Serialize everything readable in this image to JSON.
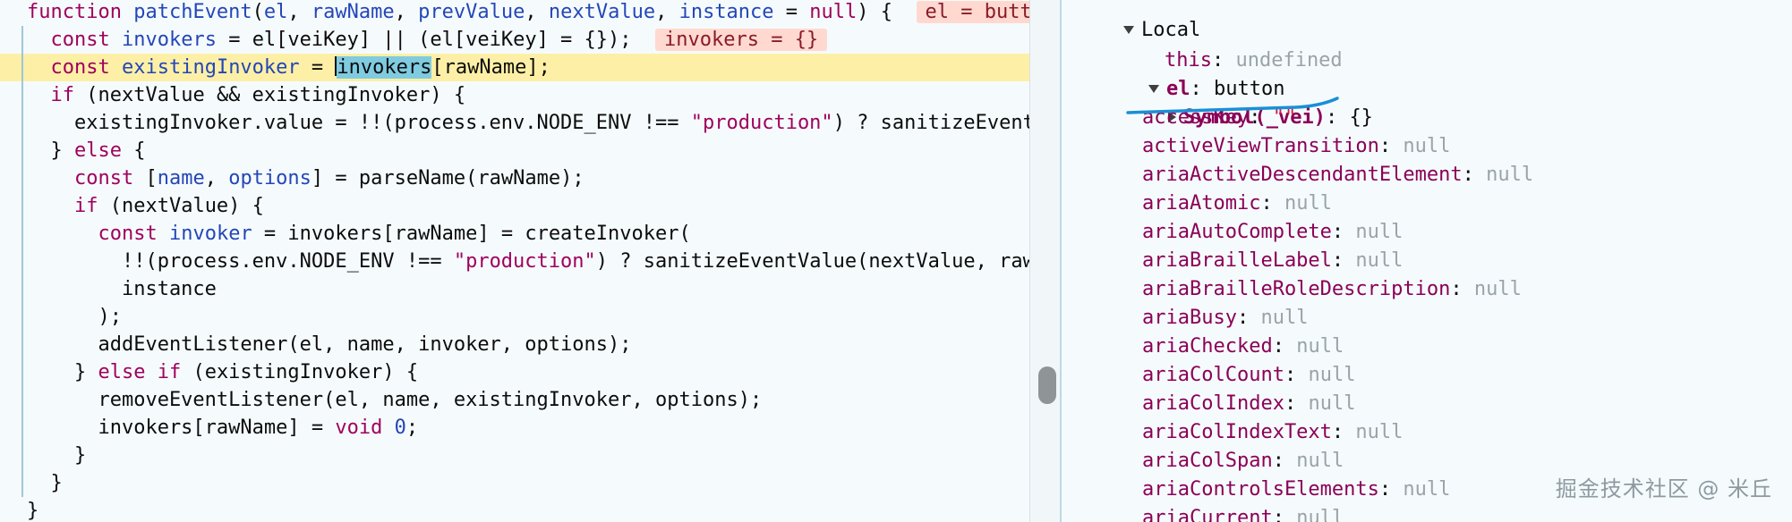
{
  "editor": {
    "lines": [
      {
        "parts": [
          [
            "kw",
            "function "
          ],
          [
            "fn",
            "patchEvent"
          ],
          [
            "",
            "("
          ],
          [
            "df",
            "el"
          ],
          [
            "",
            ", "
          ],
          [
            "df",
            "rawName"
          ],
          [
            "",
            ", "
          ],
          [
            "df",
            "prevValue"
          ],
          [
            "",
            ", "
          ],
          [
            "df",
            "nextValue"
          ],
          [
            "",
            ", "
          ],
          [
            "df",
            "instance"
          ],
          [
            "",
            " = "
          ],
          [
            "kw",
            "null"
          ],
          [
            "",
            ") {  "
          ]
        ],
        "preview": "el = button",
        "previewCut": true
      },
      {
        "parts": [
          [
            "",
            "  "
          ],
          [
            "kw",
            "const "
          ],
          [
            "df",
            "invokers"
          ],
          [
            "",
            " = el[veiKey] || (el[veiKey] = {});  "
          ]
        ],
        "preview": "invokers = {}"
      },
      {
        "parts": [
          [
            "",
            "  "
          ],
          [
            "kw",
            "const "
          ],
          [
            "df",
            "existingInvoker"
          ],
          [
            "",
            " = "
          ],
          [
            "cursor",
            ""
          ],
          [
            "sel",
            "invokers"
          ],
          [
            "",
            "[rawName];"
          ]
        ],
        "highlight": true
      },
      {
        "parts": [
          [
            "",
            "  "
          ],
          [
            "kw",
            "if"
          ],
          [
            "",
            " (nextValue && existingInvoker) {"
          ]
        ]
      },
      {
        "parts": [
          [
            "",
            "    existingInvoker.value = !!(process.env.NODE_ENV !== "
          ],
          [
            "str",
            "\"production\""
          ],
          [
            "",
            ") ? sanitizeEvent"
          ],
          [
            "fade",
            "Va"
          ]
        ]
      },
      {
        "parts": [
          [
            "",
            "  } "
          ],
          [
            "kw",
            "else"
          ],
          [
            "",
            " {"
          ]
        ]
      },
      {
        "parts": [
          [
            "",
            "    "
          ],
          [
            "kw",
            "const "
          ],
          [
            "",
            "["
          ],
          [
            "df",
            "name"
          ],
          [
            "",
            ", "
          ],
          [
            "df",
            "options"
          ],
          [
            "",
            "] = parseName(rawName);"
          ]
        ]
      },
      {
        "parts": [
          [
            "",
            "    "
          ],
          [
            "kw",
            "if"
          ],
          [
            "",
            " (nextValue) {"
          ]
        ]
      },
      {
        "parts": [
          [
            "",
            "      "
          ],
          [
            "kw",
            "const "
          ],
          [
            "df",
            "invoker"
          ],
          [
            "",
            " = invokers[rawName] = createInvoker("
          ]
        ]
      },
      {
        "parts": [
          [
            "",
            "        !!(process.env.NODE_ENV !== "
          ],
          [
            "str",
            "\"production\""
          ],
          [
            "",
            ") ? sanitizeEventValue(nextValue, raw"
          ],
          [
            "fade",
            "Na"
          ]
        ]
      },
      {
        "parts": [
          [
            "",
            "        instance"
          ]
        ]
      },
      {
        "parts": [
          [
            "",
            "      );"
          ]
        ]
      },
      {
        "parts": [
          [
            "",
            "      addEventListener(el, name, invoker, options);"
          ]
        ]
      },
      {
        "parts": [
          [
            "",
            "    } "
          ],
          [
            "kw",
            "else if"
          ],
          [
            "",
            " (existingInvoker) {"
          ]
        ]
      },
      {
        "parts": [
          [
            "",
            "      removeEventListener(el, name, existingInvoker, options);"
          ]
        ]
      },
      {
        "parts": [
          [
            "",
            "      invokers[rawName] = "
          ],
          [
            "kw",
            "void "
          ],
          [
            "num",
            "0"
          ],
          [
            "",
            ";"
          ]
        ]
      },
      {
        "parts": [
          [
            "",
            "    }"
          ]
        ]
      },
      {
        "parts": [
          [
            "",
            "  }"
          ]
        ]
      },
      {
        "parts": [
          [
            "",
            "}"
          ]
        ]
      }
    ]
  },
  "scopes": {
    "section_label": "Local",
    "this_key": "this",
    "this_value": "undefined",
    "el_key": "el",
    "el_value": "button",
    "symbol_key": "Symbol(_vei)",
    "symbol_value": "{}",
    "properties": [
      {
        "key": "accessKey",
        "value": "\"\"",
        "kind": "string"
      },
      {
        "key": "activeViewTransition",
        "value": "null",
        "kind": "null"
      },
      {
        "key": "ariaActiveDescendantElement",
        "value": "null",
        "kind": "null"
      },
      {
        "key": "ariaAtomic",
        "value": "null",
        "kind": "null"
      },
      {
        "key": "ariaAutoComplete",
        "value": "null",
        "kind": "null"
      },
      {
        "key": "ariaBrailleLabel",
        "value": "null",
        "kind": "null"
      },
      {
        "key": "ariaBrailleRoleDescription",
        "value": "null",
        "kind": "null"
      },
      {
        "key": "ariaBusy",
        "value": "null",
        "kind": "null"
      },
      {
        "key": "ariaChecked",
        "value": "null",
        "kind": "null"
      },
      {
        "key": "ariaColCount",
        "value": "null",
        "kind": "null"
      },
      {
        "key": "ariaColIndex",
        "value": "null",
        "kind": "null"
      },
      {
        "key": "ariaColIndexText",
        "value": "null",
        "kind": "null"
      },
      {
        "key": "ariaColSpan",
        "value": "null",
        "kind": "null"
      },
      {
        "key": "ariaControlsElements",
        "value": "null",
        "kind": "null"
      },
      {
        "key": "ariaCurrent",
        "value": "null",
        "kind": "null"
      }
    ]
  },
  "watermark": "掘金技术社区 @ 米丘",
  "colors": {
    "keyword": "#a0005d",
    "identifier": "#2446b8",
    "highlight_line": "#fdf0a6",
    "selection": "#7fcbe0",
    "annotation_stroke": "#1a8fd6"
  }
}
